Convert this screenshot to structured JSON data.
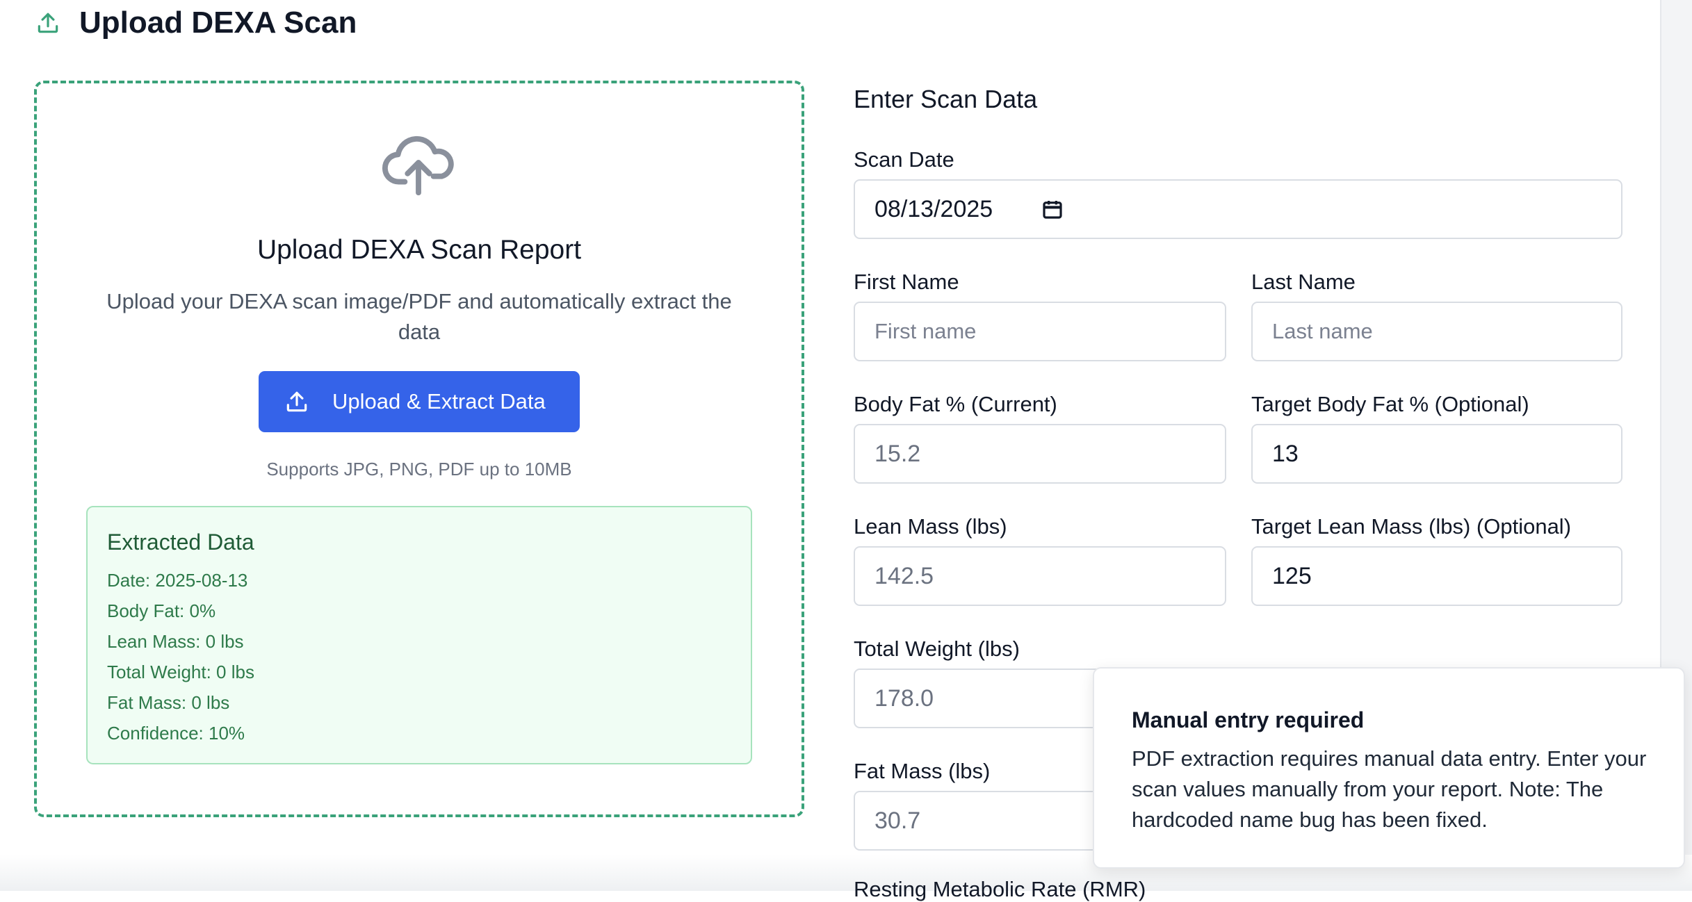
{
  "page": {
    "title": "Upload DEXA Scan",
    "icons": {
      "title": "upload-icon",
      "cloud": "cloud-upload-icon",
      "button": "upload-icon",
      "date": "calendar-icon"
    },
    "colors": {
      "accent_blue": "#3563e9",
      "dashed_border": "#3aa27a",
      "success_bg": "#f0fdf4",
      "success_text": "#2e7a4a"
    }
  },
  "upload": {
    "heading": "Upload DEXA Scan Report",
    "description": "Upload your DEXA scan image/PDF and automatically extract the data",
    "button_label": "Upload & Extract Data",
    "supports": "Supports JPG, PNG, PDF up to 10MB"
  },
  "extracted": {
    "title": "Extracted Data",
    "date": "Date: 2025-08-13",
    "body_fat": "Body Fat: 0%",
    "lean_mass": "Lean Mass: 0 lbs",
    "total_weight": "Total Weight: 0 lbs",
    "fat_mass": "Fat Mass: 0 lbs",
    "confidence": "Confidence: 10%"
  },
  "form": {
    "heading": "Enter Scan Data",
    "scan_date": {
      "label": "Scan Date",
      "value": "08/13/2025"
    },
    "first_name": {
      "label": "First Name",
      "placeholder": "First name"
    },
    "last_name": {
      "label": "Last Name",
      "placeholder": "Last name"
    },
    "body_fat": {
      "label": "Body Fat % (Current)",
      "value": "15.2"
    },
    "target_body_fat": {
      "label": "Target Body Fat % (Optional)",
      "value": "13"
    },
    "lean_mass": {
      "label": "Lean Mass (lbs)",
      "value": "142.5"
    },
    "target_lean_mass": {
      "label": "Target Lean Mass (lbs) (Optional)",
      "value": "125"
    },
    "total_weight": {
      "label": "Total Weight (lbs)",
      "value": "178.0"
    },
    "fat_mass": {
      "label": "Fat Mass (lbs)",
      "value": "30.7"
    },
    "rmr": {
      "label": "Resting Metabolic Rate (RMR)"
    }
  },
  "toast": {
    "title": "Manual entry required",
    "message": "PDF extraction requires manual data entry. Enter your scan values manually from your report. Note: The hardcoded name bug has been fixed."
  }
}
